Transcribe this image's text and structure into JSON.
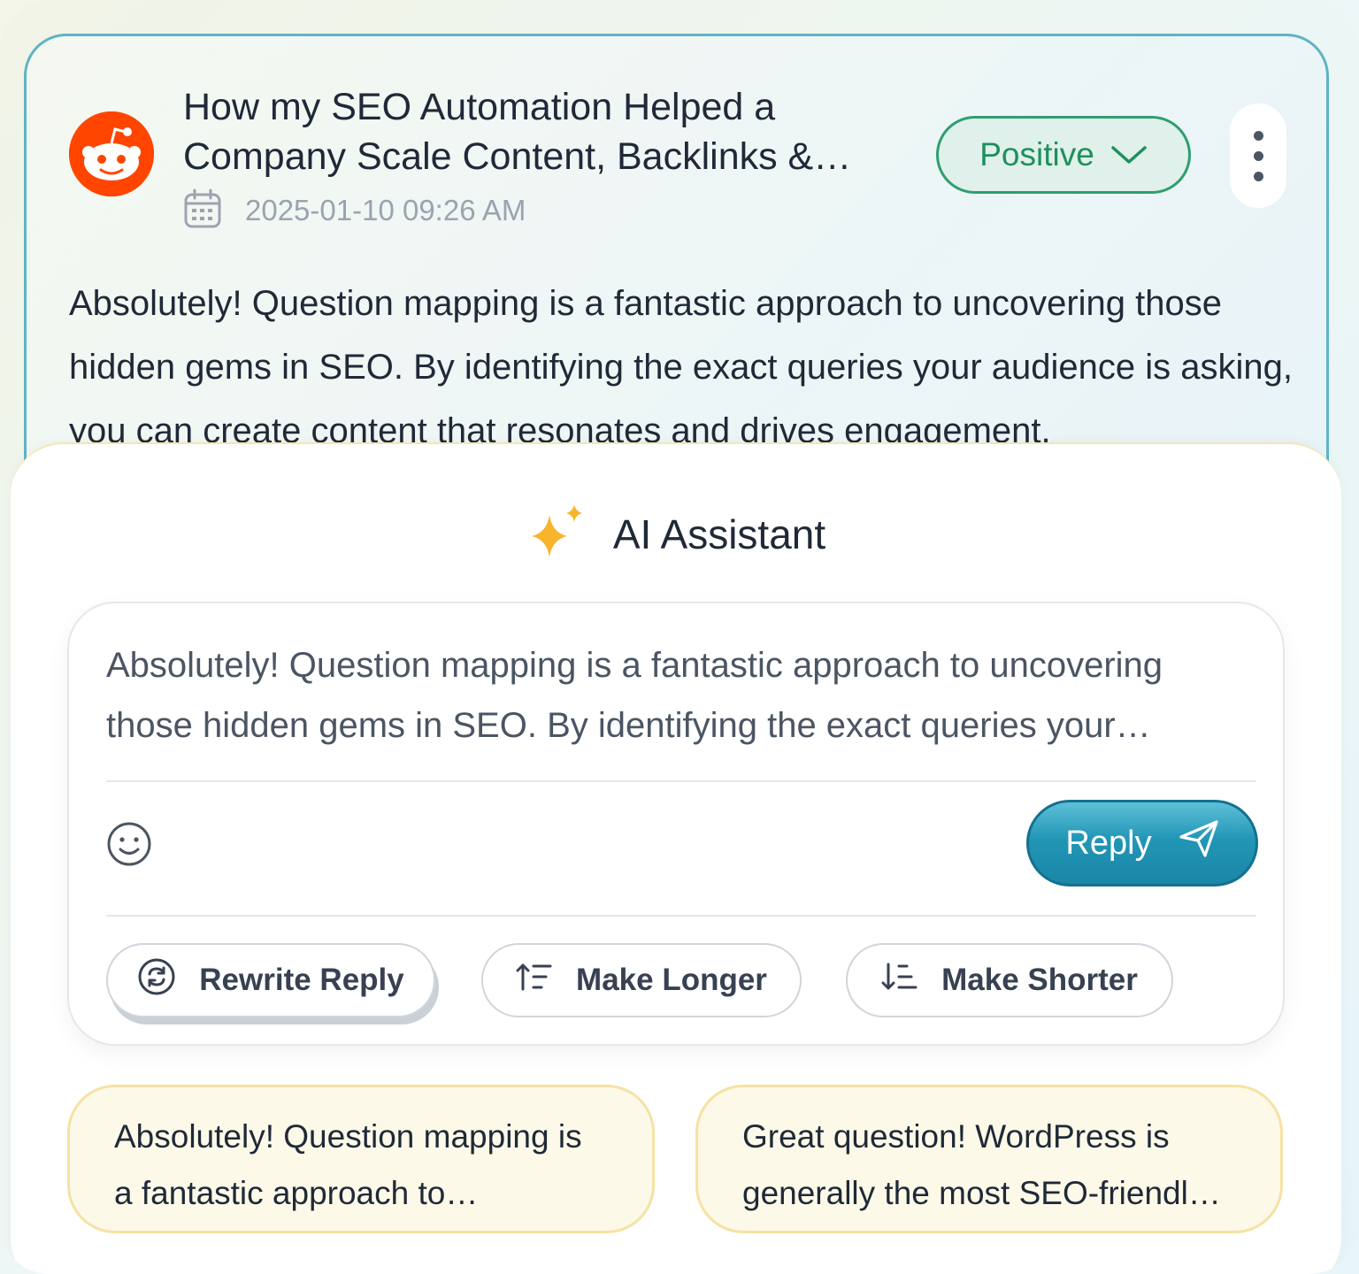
{
  "post": {
    "title": "How my SEO Automation Helped a Company Scale Content, Backlinks & Traffic",
    "date": "2025-01-10 09:26 AM",
    "sentiment": "Positive",
    "body": "Absolutely! Question mapping is a fantastic approach to uncovering those hidden gems in SEO. By identifying the exact queries your audience is asking, you can create content that resonates and drives engagement.",
    "source_icon": "reddit-icon"
  },
  "assistant": {
    "title": "AI Assistant",
    "reply_text": "Absolutely! Question mapping is a fantastic approach to uncovering those hidden gems in SEO. By identifying the exact queries your audience is asking.",
    "reply_label": "Reply",
    "actions": {
      "rewrite": "Rewrite Reply",
      "longer": "Make Longer",
      "shorter": "Make Shorter"
    },
    "suggestions": [
      "Absolutely! Question mapping is a fantastic approach to uncovering those hidden gems in SEO.",
      "Great question! WordPress is generally the most SEO-friendly platform."
    ]
  },
  "colors": {
    "accent": "#1a86a6",
    "positive": "#1f8f5e",
    "reddit": "#ff4500",
    "suggestion_bg": "#fdf9e8"
  }
}
